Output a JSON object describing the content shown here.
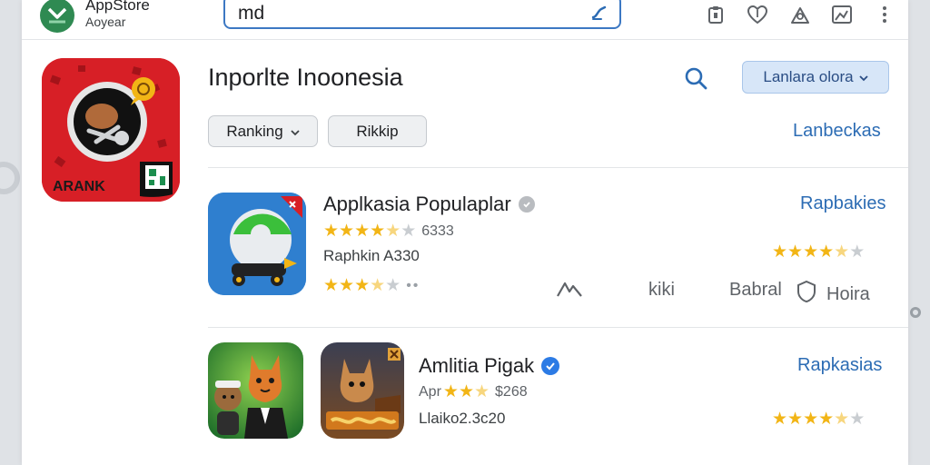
{
  "header": {
    "app_title": "AppStore",
    "app_subtitle": "Aoyear",
    "search_value": "md"
  },
  "page": {
    "title": "Inporlte Inoonesia",
    "language_select": "Lanlara olora",
    "filters": [
      "Ranking",
      "Rikkip"
    ],
    "filter_link": "Lanbeckas"
  },
  "feature_app": {
    "label": "ARANK"
  },
  "apps": [
    {
      "title": "Applkasia Populaplar",
      "rating_text": "6333",
      "stars": 4.5,
      "subline": "Raphkin A330",
      "stars2": 3.5,
      "link": "Rapbakies",
      "side_stars": 4.5,
      "actions": [
        "kiki",
        "Babral",
        "Hoira"
      ]
    },
    {
      "title": "Amlitia Pigak",
      "rating_prefix": "Apr",
      "rating_text": "$268",
      "stars": 3.5,
      "subline": "Llaiko2.3c20",
      "link": "Rapkasias",
      "side_stars": 4.5
    }
  ],
  "colors": {
    "accent": "#2c6cb4",
    "star": "#f2b516",
    "feature_red": "#d71f26"
  }
}
